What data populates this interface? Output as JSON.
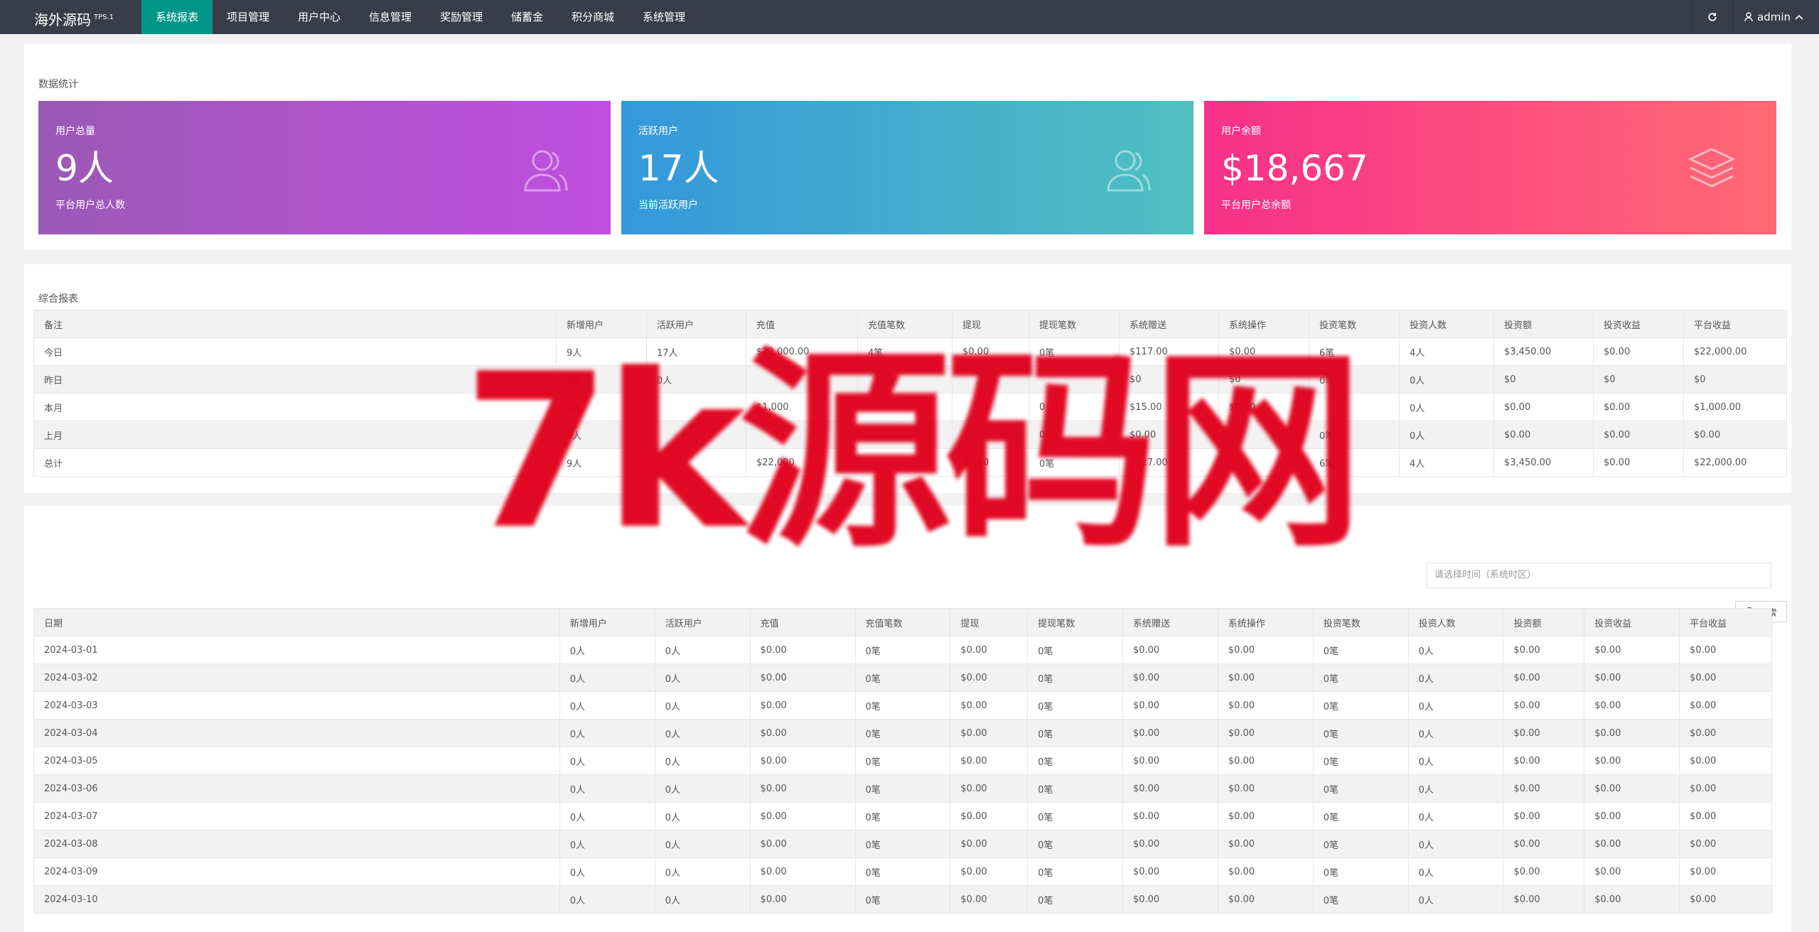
{
  "app": {
    "logo": "海外源码",
    "logo_sup": "TPS.1"
  },
  "nav": {
    "items": [
      "系统报表",
      "项目管理",
      "用户中心",
      "信息管理",
      "奖励管理",
      "储蓄金",
      "积分商城",
      "系统管理"
    ],
    "active_index": 0
  },
  "topbar": {
    "user": "admin",
    "refresh_icon": "refresh-icon",
    "user_icon": "user-icon"
  },
  "stats": {
    "title": "数据统计",
    "cards": [
      {
        "title": "用户总量",
        "value": "9人",
        "desc": "平台用户总人数",
        "icon": "users-icon",
        "gradient": [
          "#9b59b6",
          "#c14ee0"
        ]
      },
      {
        "title": "活跃用户",
        "value": "17人",
        "desc": "当前活跃用户",
        "icon": "users-icon",
        "gradient": [
          "#3498db",
          "#4fc0c0"
        ]
      },
      {
        "title": "用户余额",
        "value": "$18,667",
        "desc": "平台用户总余额",
        "icon": "layers-icon",
        "gradient": [
          "#f7308a",
          "#ff6a73"
        ]
      }
    ]
  },
  "report": {
    "title": "综合报表",
    "headers": [
      "备注",
      "新增用户",
      "活跃用户",
      "充值",
      "充值笔数",
      "提现",
      "提现笔数",
      "系统赠送",
      "系统操作",
      "投资笔数",
      "投资人数",
      "投资额",
      "投资收益",
      "平台收益"
    ],
    "rows": [
      [
        "今日",
        "9人",
        "17人",
        "$22,000.00",
        "4笔",
        "$0.00",
        "0笔",
        "$117.00",
        "$0.00",
        "6笔",
        "4人",
        "$3,450.00",
        "$0.00",
        "$22,000.00"
      ],
      [
        "昨日",
        "0人",
        "0人",
        "",
        "",
        "",
        "",
        "$0",
        "$0",
        "0笔",
        "0人",
        "$0",
        "$0",
        "$0"
      ],
      [
        "本月",
        "4人",
        "",
        "$1,000",
        "",
        "",
        "0",
        "$15.00",
        "$0.00",
        "",
        "0人",
        "$0.00",
        "$0.00",
        "$1,000.00"
      ],
      [
        "上月",
        "0人",
        "",
        "",
        "",
        "",
        "0",
        "$0.00",
        "",
        "0笔",
        "0人",
        "$0.00",
        "$0.00",
        "$0.00"
      ],
      [
        "总计",
        "9人",
        "",
        "$22,000",
        "",
        "$0.00",
        "0笔",
        "$117.00",
        "",
        "6笔",
        "4人",
        "$3,450.00",
        "$0.00",
        "$22,000.00"
      ]
    ]
  },
  "detail": {
    "title": "明细",
    "date_placeholder": "请选择时间（系统时区）",
    "search_label": "搜索",
    "headers": [
      "日期",
      "新增用户",
      "活跃用户",
      "充值",
      "充值笔数",
      "提现",
      "提现笔数",
      "系统赠送",
      "系统操作",
      "投资笔数",
      "投资人数",
      "投资额",
      "投资收益",
      "平台收益"
    ],
    "rows": [
      [
        "2024-03-01",
        "0人",
        "0人",
        "$0.00",
        "0笔",
        "$0.00",
        "0笔",
        "$0.00",
        "$0.00",
        "0笔",
        "0人",
        "$0.00",
        "$0.00",
        "$0.00"
      ],
      [
        "2024-03-02",
        "0人",
        "0人",
        "$0.00",
        "0笔",
        "$0.00",
        "0笔",
        "$0.00",
        "$0.00",
        "0笔",
        "0人",
        "$0.00",
        "$0.00",
        "$0.00"
      ],
      [
        "2024-03-03",
        "0人",
        "0人",
        "$0.00",
        "0笔",
        "$0.00",
        "0笔",
        "$0.00",
        "$0.00",
        "0笔",
        "0人",
        "$0.00",
        "$0.00",
        "$0.00"
      ],
      [
        "2024-03-04",
        "0人",
        "0人",
        "$0.00",
        "0笔",
        "$0.00",
        "0笔",
        "$0.00",
        "$0.00",
        "0笔",
        "0人",
        "$0.00",
        "$0.00",
        "$0.00"
      ],
      [
        "2024-03-05",
        "0人",
        "0人",
        "$0.00",
        "0笔",
        "$0.00",
        "0笔",
        "$0.00",
        "$0.00",
        "0笔",
        "0人",
        "$0.00",
        "$0.00",
        "$0.00"
      ],
      [
        "2024-03-06",
        "0人",
        "0人",
        "$0.00",
        "0笔",
        "$0.00",
        "0笔",
        "$0.00",
        "$0.00",
        "0笔",
        "0人",
        "$0.00",
        "$0.00",
        "$0.00"
      ],
      [
        "2024-03-07",
        "0人",
        "0人",
        "$0.00",
        "0笔",
        "$0.00",
        "0笔",
        "$0.00",
        "$0.00",
        "0笔",
        "0人",
        "$0.00",
        "$0.00",
        "$0.00"
      ],
      [
        "2024-03-08",
        "0人",
        "0人",
        "$0.00",
        "0笔",
        "$0.00",
        "0笔",
        "$0.00",
        "$0.00",
        "0笔",
        "0人",
        "$0.00",
        "$0.00",
        "$0.00"
      ],
      [
        "2024-03-09",
        "0人",
        "0人",
        "$0.00",
        "0笔",
        "$0.00",
        "0笔",
        "$0.00",
        "$0.00",
        "0笔",
        "0人",
        "$0.00",
        "$0.00",
        "$0.00"
      ],
      [
        "2024-03-10",
        "0人",
        "0人",
        "$0.00",
        "0笔",
        "$0.00",
        "0笔",
        "$0.00",
        "$0.00",
        "0笔",
        "0人",
        "$0.00",
        "$0.00",
        "$0.00"
      ]
    ]
  },
  "watermark": "7k源码网"
}
